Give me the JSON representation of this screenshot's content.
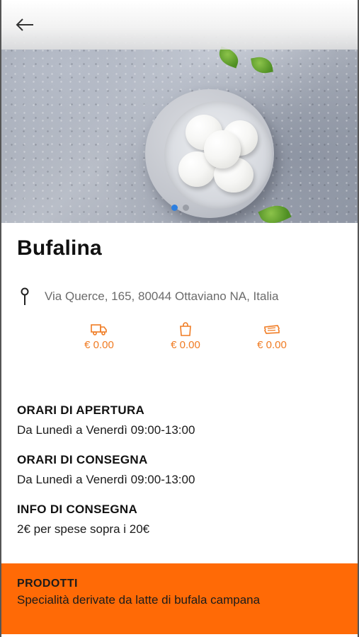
{
  "header": {
    "back_icon": "arrow-left-icon"
  },
  "hero": {
    "carousel_total": 2,
    "carousel_active": 1
  },
  "shop": {
    "name": "Bufalina",
    "address": "Via Querce, 165, 80044 Ottaviano NA, Italia"
  },
  "fees": [
    {
      "icon": "delivery-truck-icon",
      "value": "€ 0.00"
    },
    {
      "icon": "shopping-bag-icon",
      "value": "€ 0.00"
    },
    {
      "icon": "ticket-icon",
      "value": "€ 0.00"
    }
  ],
  "info": {
    "opening": {
      "label": "ORARI DI APERTURA",
      "value": "Da Lunedì a Venerdì 09:00-13:00"
    },
    "delivery_hours": {
      "label": "ORARI DI CONSEGNA",
      "value": "Da Lunedì a Venerdì 09:00-13:00"
    },
    "delivery_info": {
      "label": "INFO DI CONSEGNA",
      "value": "2€ per spese sopra i 20€"
    }
  },
  "products": {
    "title": "PRODOTTI",
    "subtitle": "Specialità derivate da latte di bufala campana"
  },
  "colors": {
    "accent": "#f07b22",
    "products_bg": "#ff6a06",
    "carousel_active": "#2d7fe0"
  }
}
